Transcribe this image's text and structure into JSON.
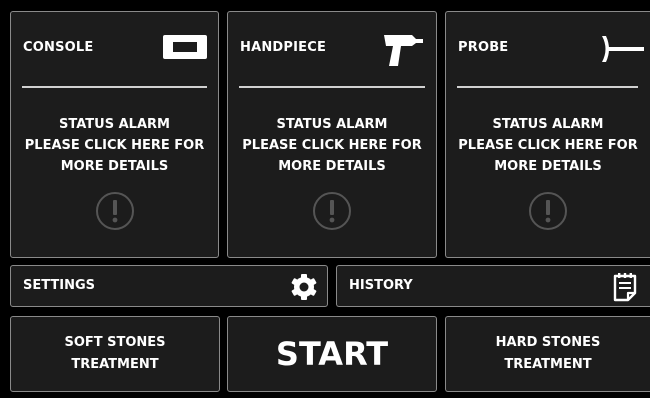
{
  "panels": [
    {
      "title": "CONSOLE",
      "icon": "console-icon",
      "status_line1": "STATUS ALARM",
      "status_line2": "PLEASE CLICK HERE FOR",
      "status_line3": "MORE DETAILS",
      "alert_icon": "exclamation-circle-icon"
    },
    {
      "title": "HANDPIECE",
      "icon": "handpiece-icon",
      "status_line1": "STATUS ALARM",
      "status_line2": "PLEASE CLICK HERE FOR",
      "status_line3": "MORE DETAILS",
      "alert_icon": "exclamation-circle-icon"
    },
    {
      "title": "PROBE",
      "icon": "probe-icon",
      "status_line1": "STATUS ALARM",
      "status_line2": "PLEASE CLICK HERE FOR",
      "status_line3": "MORE DETAILS",
      "alert_icon": "exclamation-circle-icon"
    }
  ],
  "settings": {
    "label": "SETTINGS",
    "icon": "gear-icon"
  },
  "history": {
    "label": "HISTORY",
    "icon": "notepad-icon"
  },
  "actions": {
    "soft_line1": "SOFT STONES",
    "soft_line2": "TREATMENT",
    "start": "START",
    "hard_line1": "HARD STONES",
    "hard_line2": "TREATMENT"
  },
  "colors": {
    "background": "#000000",
    "panel": "#1c1c1c",
    "border": "#8a8a8a",
    "text": "#ffffff",
    "alert": "#555555"
  }
}
